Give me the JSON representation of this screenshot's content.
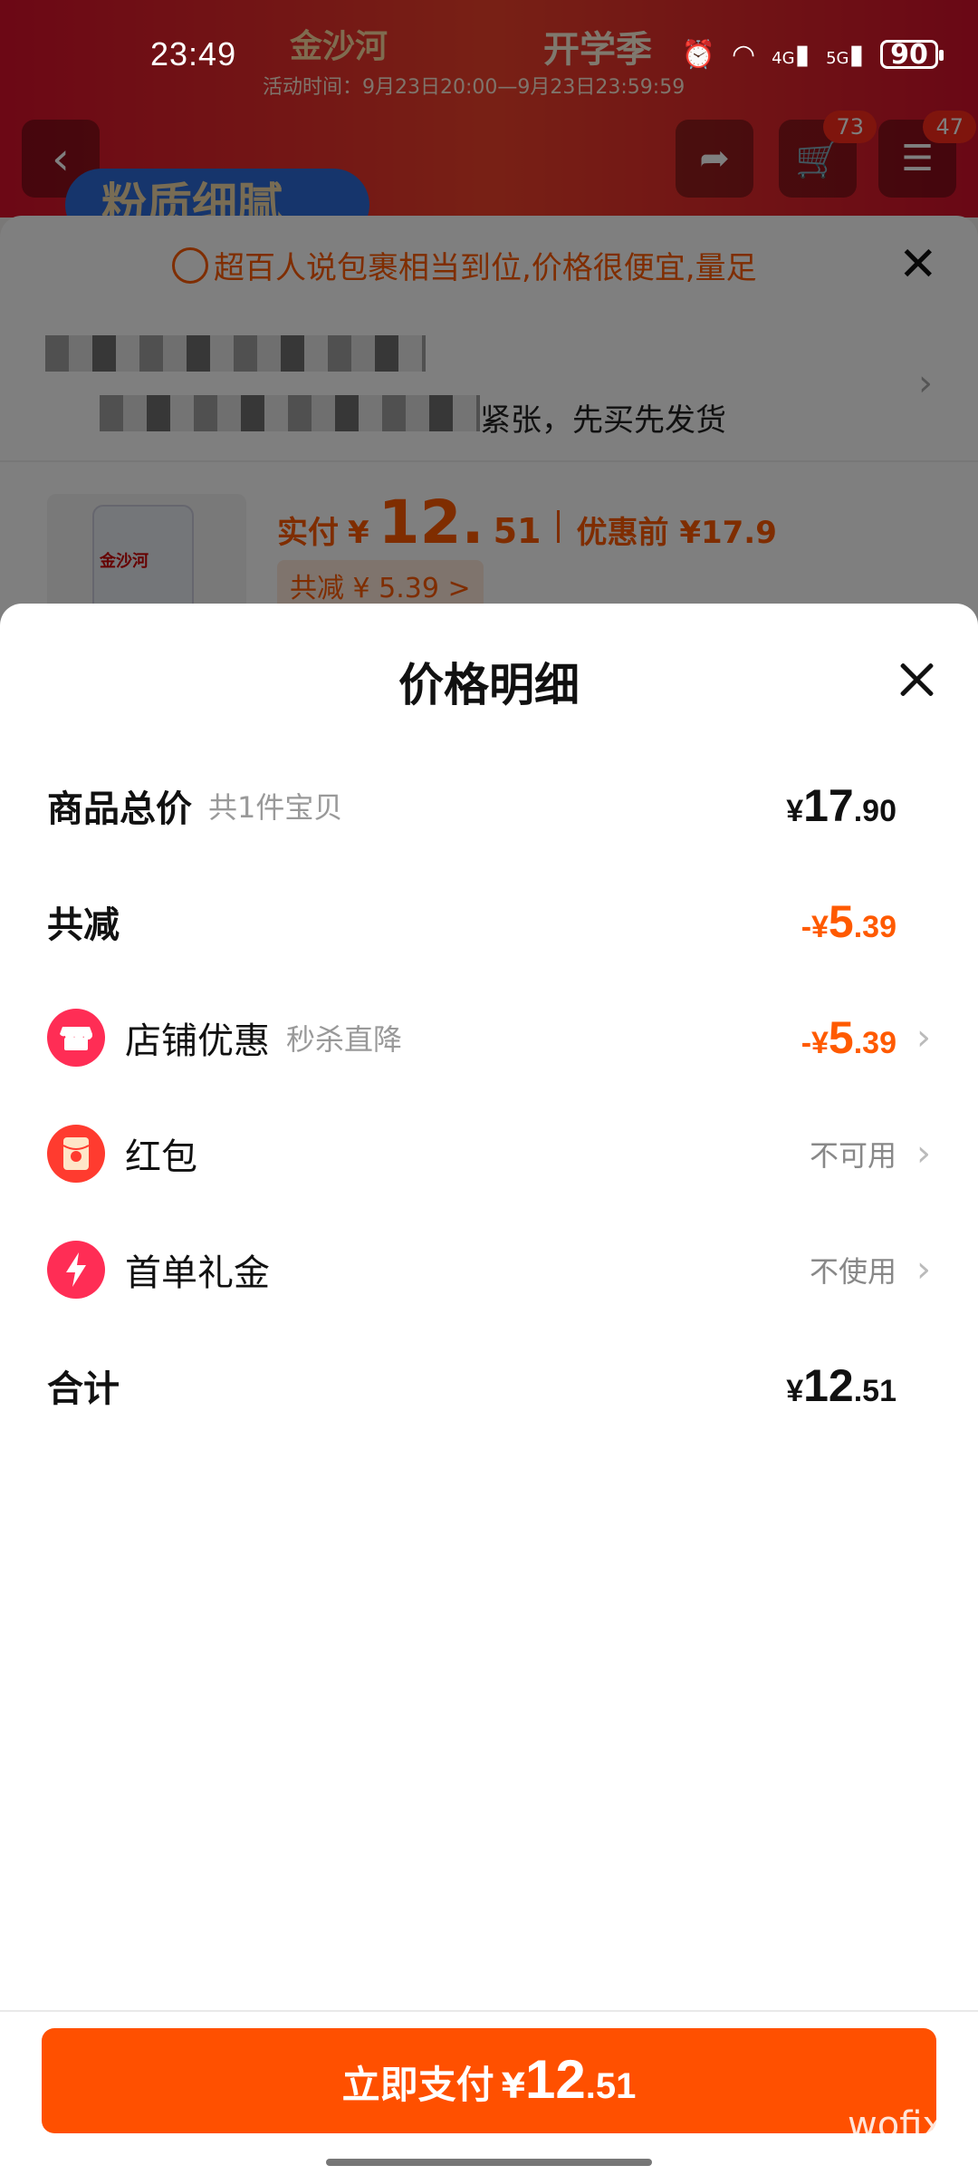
{
  "status_bar": {
    "time": "23:49",
    "network_4g": "4G",
    "network_5g": "5G",
    "battery": "90"
  },
  "background": {
    "promo_brand": "金沙河",
    "promo_event": "开学季",
    "promo_time": "活动时间：9月23日20:00—9月23日23:59:59",
    "cart_badge": "73",
    "more_badge": "47",
    "chip_text": "粉质细腻",
    "tip": "超百人说包裹相当到位,价格很便宜,量足",
    "address_tail": "紧张，先买先发货",
    "product_label": "金沙河",
    "paid_label": "实付",
    "paid_symbol": "¥",
    "paid_int": "12.",
    "paid_dec": "51",
    "before_discount": "优惠前 ¥17.9",
    "total_saved": "共减 ¥ 5.39 >"
  },
  "sheet": {
    "title": "价格明细",
    "rows": [
      {
        "name": "商品总价",
        "sub": "共1件宝贝",
        "symbol": "¥",
        "int": "17",
        "dec": ".90"
      },
      {
        "name": "共减",
        "symbol": "-¥",
        "int": "5",
        "dec": ".39"
      },
      {
        "name": "店铺优惠",
        "sub": "秒杀直降",
        "symbol": "-¥",
        "int": "5",
        "dec": ".39",
        "icon": "store-icon"
      },
      {
        "name": "红包",
        "status": "不可用",
        "icon": "red-packet-icon"
      },
      {
        "name": "首单礼金",
        "status": "不使用",
        "icon": "lightning-icon"
      },
      {
        "name": "合计",
        "symbol": "¥",
        "int": "12",
        "dec": ".51"
      }
    ]
  },
  "pay_button": {
    "label": "立即支付",
    "symbol": "¥",
    "int": "12",
    "dec": ".51"
  },
  "watermark": "wofix",
  "colors": {
    "accent": "#ff5000",
    "discount": "#ff5a00",
    "icon_red": "#ff2d55"
  }
}
